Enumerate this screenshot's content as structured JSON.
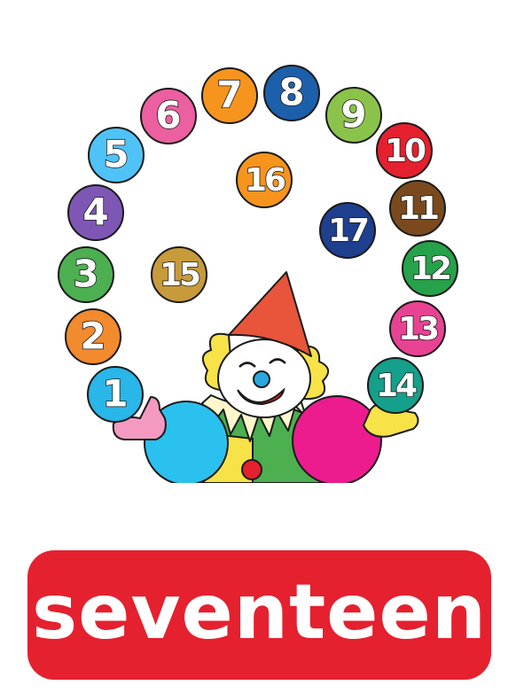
{
  "word": "seventeen",
  "balls": [
    {
      "label": "1",
      "color": "#29b6e8"
    },
    {
      "label": "2",
      "color": "#f28a2e"
    },
    {
      "label": "3",
      "color": "#4caf50"
    },
    {
      "label": "4",
      "color": "#7e57b5"
    },
    {
      "label": "5",
      "color": "#4fc3f7"
    },
    {
      "label": "6",
      "color": "#ec5fa0"
    },
    {
      "label": "7",
      "color": "#f7941d"
    },
    {
      "label": "8",
      "color": "#1c5fab"
    },
    {
      "label": "9",
      "color": "#8bc34a"
    },
    {
      "label": "10",
      "color": "#e5202f"
    },
    {
      "label": "11",
      "color": "#7a4a1e"
    },
    {
      "label": "12",
      "color": "#26a24a"
    },
    {
      "label": "13",
      "color": "#e84393"
    },
    {
      "label": "14",
      "color": "#14a08a"
    },
    {
      "label": "15",
      "color": "#c79a3a"
    },
    {
      "label": "16",
      "color": "#f7941d"
    },
    {
      "label": "17",
      "color": "#1f3f8f"
    }
  ],
  "colors": {
    "banner": "#e5202f",
    "hat": "#e8553a",
    "hair": "#f7e347",
    "nose": "#29a8e0",
    "mouth": "#e5202f",
    "ruff": "#fff6cc",
    "left_big_ball": "#2bc1ef",
    "right_big_ball": "#ec1c8e",
    "left_glove": "#f49ac1",
    "right_glove": "#f7e347"
  }
}
